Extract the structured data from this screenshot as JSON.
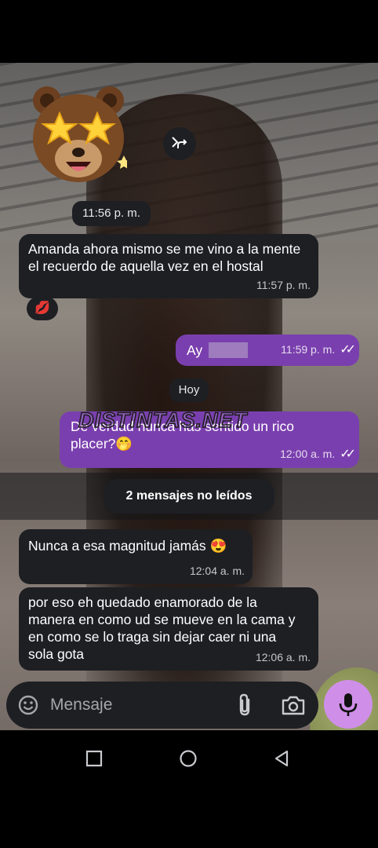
{
  "chat": {
    "sticker_time": "11:56 p. m.",
    "messages": [
      {
        "direction": "in",
        "text": "Amanda ahora mismo se me vino a la mente el recuerdo de aquella vez en el hostal",
        "time": "11:57 p. m.",
        "reaction": "💋"
      },
      {
        "direction": "out",
        "text": "Ay",
        "time": "11:59 p. m.",
        "ticks": "✓✓"
      },
      {
        "direction": "out",
        "text": "De verdad nunca has sentido un rico placer?🤭",
        "time": "12:00 a. m.",
        "ticks": "✓✓"
      },
      {
        "direction": "in",
        "text": "Nunca a esa magnitud jamás 😍",
        "time": "12:04 a. m."
      },
      {
        "direction": "in",
        "text": "por eso eh quedado enamorado de la manera en como ud se mueve en la cama y en como se lo traga sin dejar caer ni una sola gota",
        "time": "12:06 a. m."
      }
    ],
    "day_divider": "Hoy",
    "unread_banner": "2 mensajes no leídos",
    "watermark": "DISTINTAS.NET"
  },
  "composer": {
    "placeholder": "Mensaje"
  },
  "icons": {
    "forward": "forward-icon",
    "sticker_emoji": "bear-star-eyes-sticker",
    "emoji": "emoji-icon",
    "attach": "paperclip-icon",
    "camera": "camera-icon",
    "mic": "mic-icon",
    "nav_recent": "square-icon",
    "nav_home": "circle-icon",
    "nav_back": "back-triangle-icon"
  },
  "colors": {
    "incoming_bubble": "#1d1f23",
    "outgoing_bubble": "#7a3fae",
    "mic_button": "#cf8fe8"
  }
}
